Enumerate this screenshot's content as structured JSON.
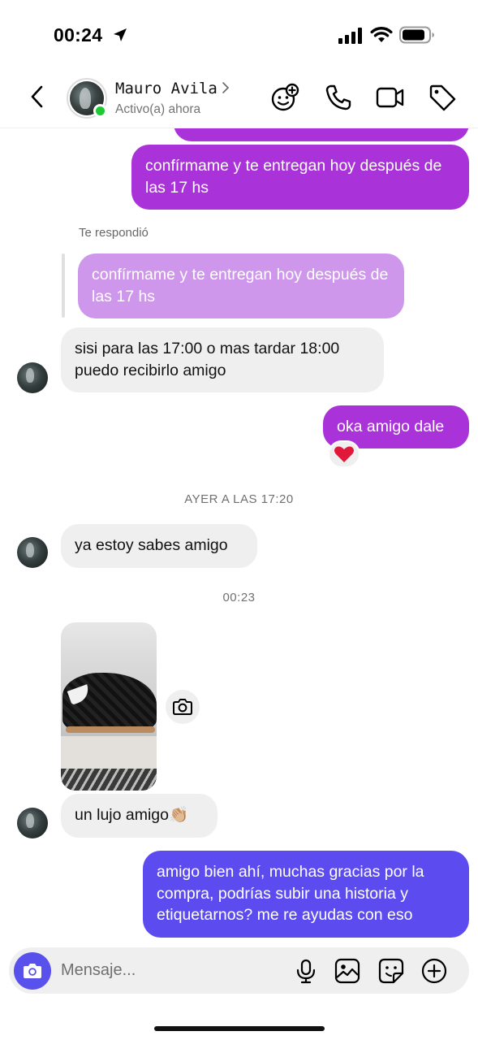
{
  "status_bar": {
    "time": "00:24"
  },
  "header": {
    "back_icon": "chevron-left-icon",
    "contact_name": "Mauro Avila",
    "contact_status": "Activo(a) ahora",
    "actions": [
      "add-effect-icon",
      "phone-icon",
      "video-icon",
      "tag-icon"
    ]
  },
  "messages": {
    "m0": {
      "text": ""
    },
    "m1": {
      "text": "confírmame y te entregan hoy después de las 17 hs"
    },
    "reply_label": "Te respondió",
    "quoted": {
      "text": "confírmame y te entregan hoy después de las 17 hs"
    },
    "m2": {
      "text": "sisi para las 17:00 o mas tardar 18:00 puedo recibirlo amigo"
    },
    "m3": {
      "text": "oka amigo dale",
      "reaction": "❤️"
    },
    "ts1": "AYER A LAS 17:20",
    "m4": {
      "text": "ya estoy sabes amigo"
    },
    "ts2": "00:23",
    "m5": {
      "text": "un lujo amigo👏🏼"
    },
    "m6": {
      "text": "amigo bien ahí, muchas gracias por la compra, podrías subir una historia y etiquetarnos? me re ayudas con eso"
    }
  },
  "composer": {
    "placeholder": "Mensaje...",
    "icons": [
      "camera-icon",
      "microphone-icon",
      "gallery-icon",
      "sticker-icon",
      "plus-icon"
    ]
  },
  "colors": {
    "outgoing_purple": "#a933d8",
    "quoted_purple": "#cf97ec",
    "outgoing_indigo": "#5c4cf0",
    "incoming_gray": "#efeff0",
    "online_green": "#1ec933",
    "camera_button": "#5851ec"
  }
}
